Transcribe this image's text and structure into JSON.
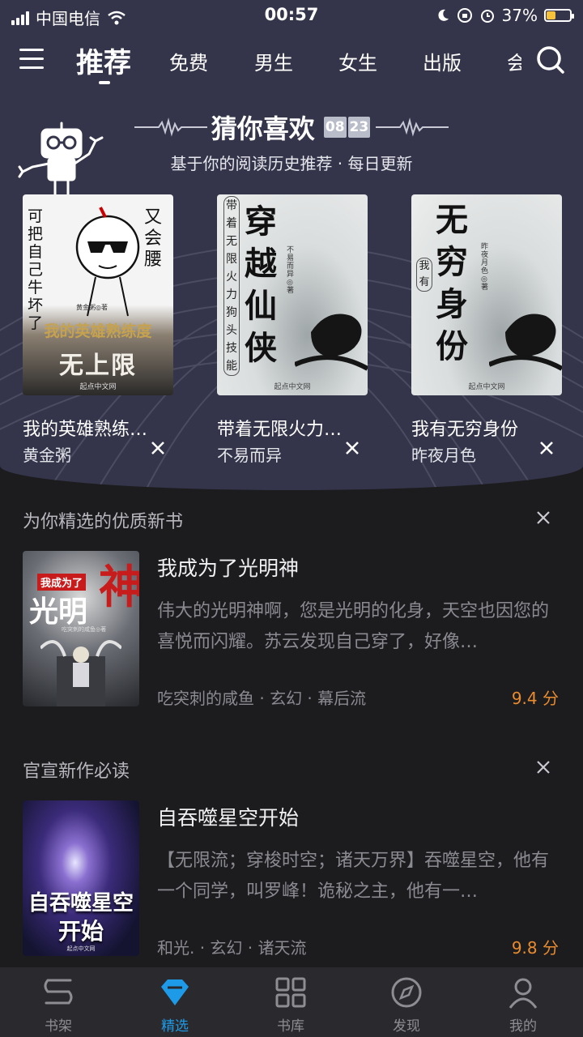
{
  "status_bar": {
    "carrier": "中国电信",
    "time": "00:57",
    "battery": "37%"
  },
  "nav": {
    "tabs": [
      {
        "label": "推荐",
        "active": true
      },
      {
        "label": "免费"
      },
      {
        "label": "男生"
      },
      {
        "label": "女生"
      },
      {
        "label": "出版"
      },
      {
        "label": "会"
      }
    ]
  },
  "guess": {
    "title": "猜你喜欢",
    "date_month": "08",
    "date_day": "23",
    "subtitle": "基于你的阅读历史推荐 · 每日更新",
    "books": [
      {
        "title": "我的英雄熟练…",
        "author": "黄金粥",
        "cover_text": [
          "可把自己牛坏了",
          "又会腰",
          "我的英雄熟练度",
          "无上限"
        ],
        "cover_author": "黄金粥◎著",
        "publisher": "起点中文网"
      },
      {
        "title": "带着无限火力…",
        "author": "不易而异",
        "cover_text": [
          "穿越仙侠",
          "带着无限火力狗头技能"
        ],
        "cover_author": "不易而异◎著",
        "publisher": "起点中文网"
      },
      {
        "title": "我有无穷身份",
        "author": "昨夜月色",
        "cover_text": [
          "无穷身份",
          "我有"
        ],
        "cover_author": "昨夜月色◎著",
        "publisher": "起点中文网"
      }
    ]
  },
  "sections": [
    {
      "header": "为你精选的优质新书",
      "book": {
        "title": "我成为了光明神",
        "desc": "伟大的光明神啊，您是光明的化身，天空也因您的喜悦而闪耀。苏云发现自己穿了，好像…",
        "meta": "吃突刺的咸鱼 · 玄幻 · 幕后流",
        "score": "9.4 分",
        "cover_tag": "我成为了",
        "cover_big": "光明",
        "cover_god": "神",
        "cover_author": "吃突刺的咸鱼◎著"
      }
    },
    {
      "header": "官宣新作必读",
      "book": {
        "title": "自吞噬星空开始",
        "desc": "【无限流；穿梭时空；诸天万界】吞噬星空，他有一个同学，叫罗峰！诡秘之主，他有一…",
        "meta": "和光. · 玄幻 · 诸天流",
        "score": "9.8 分",
        "cover_big1": "自吞噬星空",
        "cover_big2": "开始",
        "publisher": "起点中文网"
      }
    }
  ],
  "tabbar": [
    {
      "label": "书架",
      "icon": "bookshelf-icon"
    },
    {
      "label": "精选",
      "icon": "diamond-icon",
      "active": true
    },
    {
      "label": "书库",
      "icon": "grid-icon"
    },
    {
      "label": "发现",
      "icon": "compass-icon"
    },
    {
      "label": "我的",
      "icon": "person-icon"
    }
  ],
  "colors": {
    "hero_bg": "#34354a",
    "feed_bg": "#1c1c1f",
    "accent": "#1e9be8",
    "score": "#e98b2f"
  }
}
